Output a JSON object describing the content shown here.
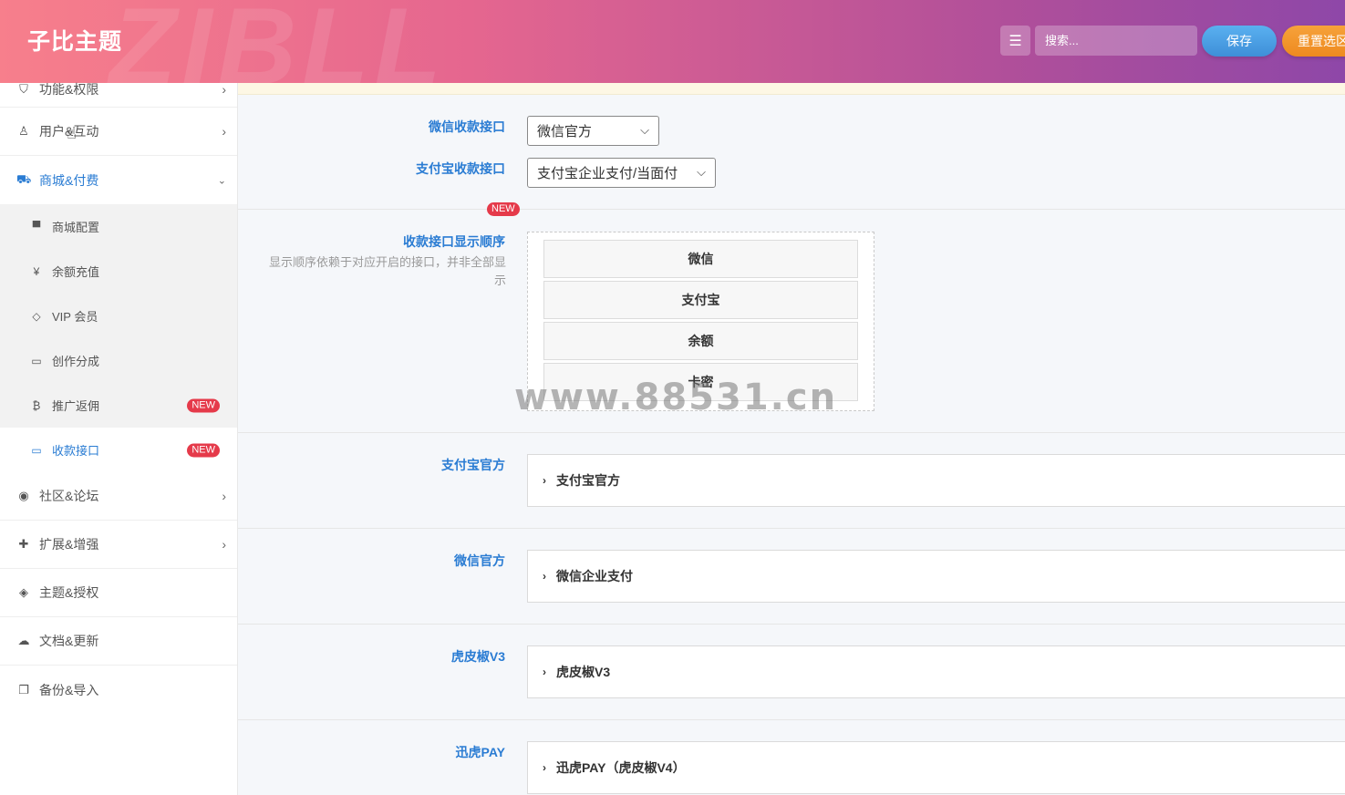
{
  "header": {
    "brand": "子比主题",
    "watermark_logo": "ZIBLL",
    "search_placeholder": "搜索...",
    "save_label": "保存",
    "reset_label": "重置选区"
  },
  "sidebar": {
    "items_top": [
      {
        "label": "功能&权限",
        "icon": "shield-icon",
        "glyph": "⛉"
      },
      {
        "label": "用户&互动",
        "icon": "user-icon",
        "glyph": "♙"
      }
    ],
    "open_item": {
      "label": "商城&付费",
      "icon": "cart-icon",
      "glyph": "🛒"
    },
    "sub_items": [
      {
        "label": "商城配置",
        "icon": "shopping-bag-icon",
        "glyph": "👜",
        "badge": ""
      },
      {
        "label": "余额充值",
        "icon": "yen-icon",
        "glyph": "¥",
        "badge": ""
      },
      {
        "label": "VIP 会员",
        "icon": "diamond-icon",
        "glyph": "◇",
        "badge": ""
      },
      {
        "label": "创作分成",
        "icon": "inbox-icon",
        "glyph": "▭",
        "badge": ""
      },
      {
        "label": "推广返佣",
        "icon": "bitcoin-icon",
        "glyph": "₿",
        "badge": "NEW"
      },
      {
        "label": "收款接口",
        "icon": "credit-card-icon",
        "glyph": "▭",
        "badge": "NEW"
      }
    ],
    "items_bottom": [
      {
        "label": "社区&论坛",
        "icon": "compass-icon",
        "glyph": "◉",
        "arrow": true
      },
      {
        "label": "扩展&增强",
        "icon": "puzzle-icon",
        "glyph": "✚",
        "arrow": true
      },
      {
        "label": "主题&授权",
        "icon": "gitlab-icon",
        "glyph": "◈",
        "arrow": false
      },
      {
        "label": "文档&更新",
        "icon": "cloud-upload-icon",
        "glyph": "☁",
        "arrow": false
      },
      {
        "label": "备份&导入",
        "icon": "copy-icon",
        "glyph": "❐",
        "arrow": false
      }
    ]
  },
  "main": {
    "wechat_interface": {
      "label": "微信收款接口",
      "value": "微信官方"
    },
    "alipay_interface": {
      "label": "支付宝收款接口",
      "value": "支付宝企业支付/当面付"
    },
    "new_tag": "NEW",
    "sort_order": {
      "label": "收款接口显示顺序",
      "desc": "显示顺序依赖于对应开启的接口，并非全部显示",
      "items": [
        "微信",
        "支付宝",
        "余额",
        "卡密"
      ]
    },
    "sections": [
      {
        "label": "支付宝官方",
        "accordion": "支付宝官方"
      },
      {
        "label": "微信官方",
        "accordion": "微信企业支付"
      },
      {
        "label": "虎皮椒V3",
        "accordion": "虎皮椒V3"
      },
      {
        "label": "迅虎PAY",
        "accordion": "迅虎PAY（虎皮椒V4）"
      }
    ],
    "watermark": "www.88531.cn"
  }
}
